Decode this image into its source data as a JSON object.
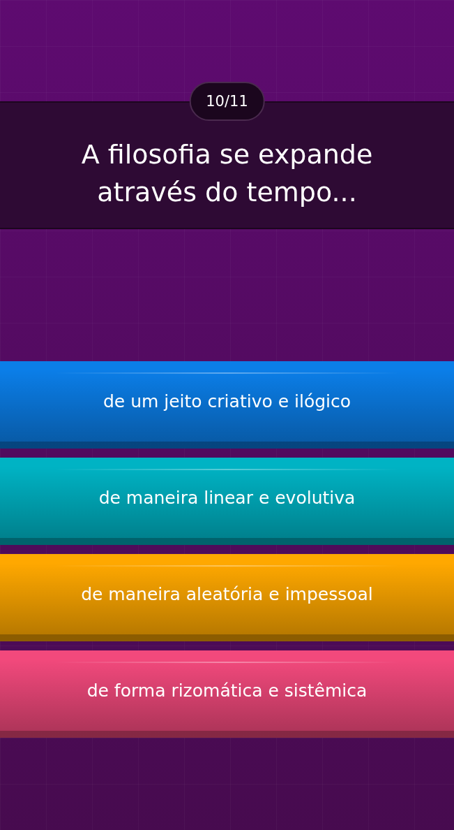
{
  "counter": "10/11",
  "question": "A filosofia se expande através do tempo...",
  "answers": [
    {
      "text": "de um jeito criativo e ilógico",
      "color": "#0b7ee8"
    },
    {
      "text": "de maneira linear e evolutiva",
      "color": "#00b3c4"
    },
    {
      "text": "de maneira aleatória e impessoal",
      "color": "#ffa800"
    },
    {
      "text": "de forma rizomática e sistêmica",
      "color": "#f2497c"
    }
  ]
}
